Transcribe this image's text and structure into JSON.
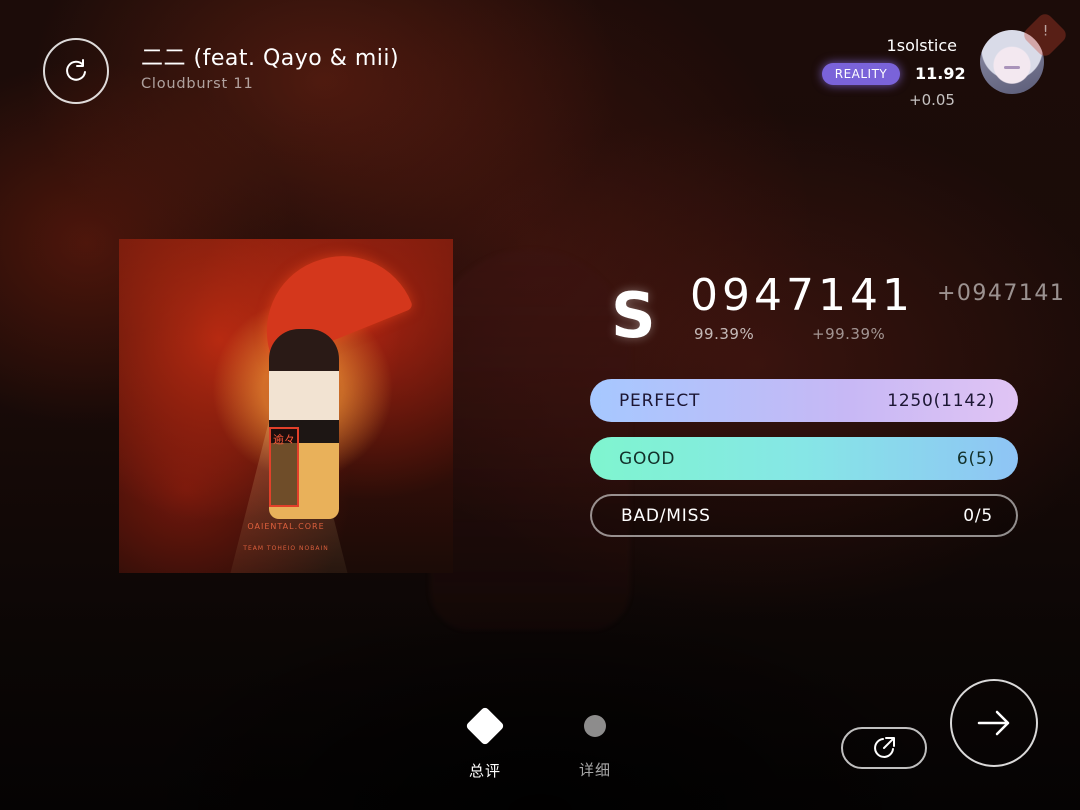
{
  "song": {
    "title": "二二 (feat. Qayo & mii)",
    "level": "Cloudburst 11"
  },
  "player": {
    "name": "1solstice",
    "badge": "REALITY",
    "rks": "11.92",
    "rks_delta": "+0.05"
  },
  "cover": {
    "seal_text": "逾々",
    "line1": "OAIENTAL.CORE",
    "line2": "TEAM TOHEIO NOBAIN"
  },
  "result": {
    "grade": "S",
    "score": "0947141",
    "score_delta": "+0947141",
    "accuracy": "99.39%",
    "accuracy_delta": "+99.39%"
  },
  "judgements": {
    "perfect": {
      "label": "PERFECT",
      "value": "1250(1142)"
    },
    "good": {
      "label": "GOOD",
      "value": "6(5)"
    },
    "bad_miss": {
      "label": "BAD/MISS",
      "value": "0/5"
    }
  },
  "tabs": [
    {
      "label": "总评",
      "icon": "diamond-icon",
      "active": true
    },
    {
      "label": "详细",
      "icon": "dot-icon",
      "active": false
    }
  ],
  "icons": {
    "retry": "retry-icon",
    "share": "share-icon",
    "next": "arrow-right-icon"
  },
  "colors": {
    "perfect_start": "#a6c8ff",
    "perfect_end": "#e0c4f4",
    "good_start": "#7ff5cf",
    "good_end": "#8fc4f5",
    "badge": "#7a63d9"
  }
}
